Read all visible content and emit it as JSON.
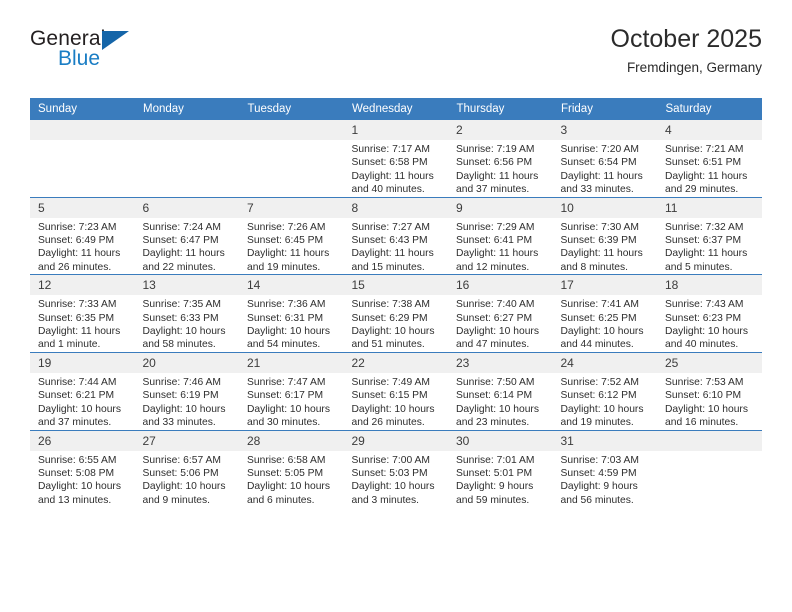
{
  "brand": {
    "name_part1": "General",
    "name_part2": "Blue",
    "triangle_color": "#1565a8",
    "blue_color": "#1a7dc4"
  },
  "header": {
    "title": "October 2025",
    "subtitle": "Fremdingen, Germany"
  },
  "theme": {
    "header_row_bg": "#3a7cbd",
    "header_row_text": "#ffffff",
    "daynum_bg": "#f0f0f0",
    "row_divider": "#3a7cbd"
  },
  "weekdays": [
    "Sunday",
    "Monday",
    "Tuesday",
    "Wednesday",
    "Thursday",
    "Friday",
    "Saturday"
  ],
  "weeks": [
    [
      {
        "empty": true
      },
      {
        "empty": true
      },
      {
        "empty": true
      },
      {
        "day": "1",
        "sunrise": "Sunrise: 7:17 AM",
        "sunset": "Sunset: 6:58 PM",
        "daylight": "Daylight: 11 hours and 40 minutes."
      },
      {
        "day": "2",
        "sunrise": "Sunrise: 7:19 AM",
        "sunset": "Sunset: 6:56 PM",
        "daylight": "Daylight: 11 hours and 37 minutes."
      },
      {
        "day": "3",
        "sunrise": "Sunrise: 7:20 AM",
        "sunset": "Sunset: 6:54 PM",
        "daylight": "Daylight: 11 hours and 33 minutes."
      },
      {
        "day": "4",
        "sunrise": "Sunrise: 7:21 AM",
        "sunset": "Sunset: 6:51 PM",
        "daylight": "Daylight: 11 hours and 29 minutes."
      }
    ],
    [
      {
        "day": "5",
        "sunrise": "Sunrise: 7:23 AM",
        "sunset": "Sunset: 6:49 PM",
        "daylight": "Daylight: 11 hours and 26 minutes."
      },
      {
        "day": "6",
        "sunrise": "Sunrise: 7:24 AM",
        "sunset": "Sunset: 6:47 PM",
        "daylight": "Daylight: 11 hours and 22 minutes."
      },
      {
        "day": "7",
        "sunrise": "Sunrise: 7:26 AM",
        "sunset": "Sunset: 6:45 PM",
        "daylight": "Daylight: 11 hours and 19 minutes."
      },
      {
        "day": "8",
        "sunrise": "Sunrise: 7:27 AM",
        "sunset": "Sunset: 6:43 PM",
        "daylight": "Daylight: 11 hours and 15 minutes."
      },
      {
        "day": "9",
        "sunrise": "Sunrise: 7:29 AM",
        "sunset": "Sunset: 6:41 PM",
        "daylight": "Daylight: 11 hours and 12 minutes."
      },
      {
        "day": "10",
        "sunrise": "Sunrise: 7:30 AM",
        "sunset": "Sunset: 6:39 PM",
        "daylight": "Daylight: 11 hours and 8 minutes."
      },
      {
        "day": "11",
        "sunrise": "Sunrise: 7:32 AM",
        "sunset": "Sunset: 6:37 PM",
        "daylight": "Daylight: 11 hours and 5 minutes."
      }
    ],
    [
      {
        "day": "12",
        "sunrise": "Sunrise: 7:33 AM",
        "sunset": "Sunset: 6:35 PM",
        "daylight": "Daylight: 11 hours and 1 minute."
      },
      {
        "day": "13",
        "sunrise": "Sunrise: 7:35 AM",
        "sunset": "Sunset: 6:33 PM",
        "daylight": "Daylight: 10 hours and 58 minutes."
      },
      {
        "day": "14",
        "sunrise": "Sunrise: 7:36 AM",
        "sunset": "Sunset: 6:31 PM",
        "daylight": "Daylight: 10 hours and 54 minutes."
      },
      {
        "day": "15",
        "sunrise": "Sunrise: 7:38 AM",
        "sunset": "Sunset: 6:29 PM",
        "daylight": "Daylight: 10 hours and 51 minutes."
      },
      {
        "day": "16",
        "sunrise": "Sunrise: 7:40 AM",
        "sunset": "Sunset: 6:27 PM",
        "daylight": "Daylight: 10 hours and 47 minutes."
      },
      {
        "day": "17",
        "sunrise": "Sunrise: 7:41 AM",
        "sunset": "Sunset: 6:25 PM",
        "daylight": "Daylight: 10 hours and 44 minutes."
      },
      {
        "day": "18",
        "sunrise": "Sunrise: 7:43 AM",
        "sunset": "Sunset: 6:23 PM",
        "daylight": "Daylight: 10 hours and 40 minutes."
      }
    ],
    [
      {
        "day": "19",
        "sunrise": "Sunrise: 7:44 AM",
        "sunset": "Sunset: 6:21 PM",
        "daylight": "Daylight: 10 hours and 37 minutes."
      },
      {
        "day": "20",
        "sunrise": "Sunrise: 7:46 AM",
        "sunset": "Sunset: 6:19 PM",
        "daylight": "Daylight: 10 hours and 33 minutes."
      },
      {
        "day": "21",
        "sunrise": "Sunrise: 7:47 AM",
        "sunset": "Sunset: 6:17 PM",
        "daylight": "Daylight: 10 hours and 30 minutes."
      },
      {
        "day": "22",
        "sunrise": "Sunrise: 7:49 AM",
        "sunset": "Sunset: 6:15 PM",
        "daylight": "Daylight: 10 hours and 26 minutes."
      },
      {
        "day": "23",
        "sunrise": "Sunrise: 7:50 AM",
        "sunset": "Sunset: 6:14 PM",
        "daylight": "Daylight: 10 hours and 23 minutes."
      },
      {
        "day": "24",
        "sunrise": "Sunrise: 7:52 AM",
        "sunset": "Sunset: 6:12 PM",
        "daylight": "Daylight: 10 hours and 19 minutes."
      },
      {
        "day": "25",
        "sunrise": "Sunrise: 7:53 AM",
        "sunset": "Sunset: 6:10 PM",
        "daylight": "Daylight: 10 hours and 16 minutes."
      }
    ],
    [
      {
        "day": "26",
        "sunrise": "Sunrise: 6:55 AM",
        "sunset": "Sunset: 5:08 PM",
        "daylight": "Daylight: 10 hours and 13 minutes."
      },
      {
        "day": "27",
        "sunrise": "Sunrise: 6:57 AM",
        "sunset": "Sunset: 5:06 PM",
        "daylight": "Daylight: 10 hours and 9 minutes."
      },
      {
        "day": "28",
        "sunrise": "Sunrise: 6:58 AM",
        "sunset": "Sunset: 5:05 PM",
        "daylight": "Daylight: 10 hours and 6 minutes."
      },
      {
        "day": "29",
        "sunrise": "Sunrise: 7:00 AM",
        "sunset": "Sunset: 5:03 PM",
        "daylight": "Daylight: 10 hours and 3 minutes."
      },
      {
        "day": "30",
        "sunrise": "Sunrise: 7:01 AM",
        "sunset": "Sunset: 5:01 PM",
        "daylight": "Daylight: 9 hours and 59 minutes."
      },
      {
        "day": "31",
        "sunrise": "Sunrise: 7:03 AM",
        "sunset": "Sunset: 4:59 PM",
        "daylight": "Daylight: 9 hours and 56 minutes."
      },
      {
        "empty": true
      }
    ]
  ]
}
